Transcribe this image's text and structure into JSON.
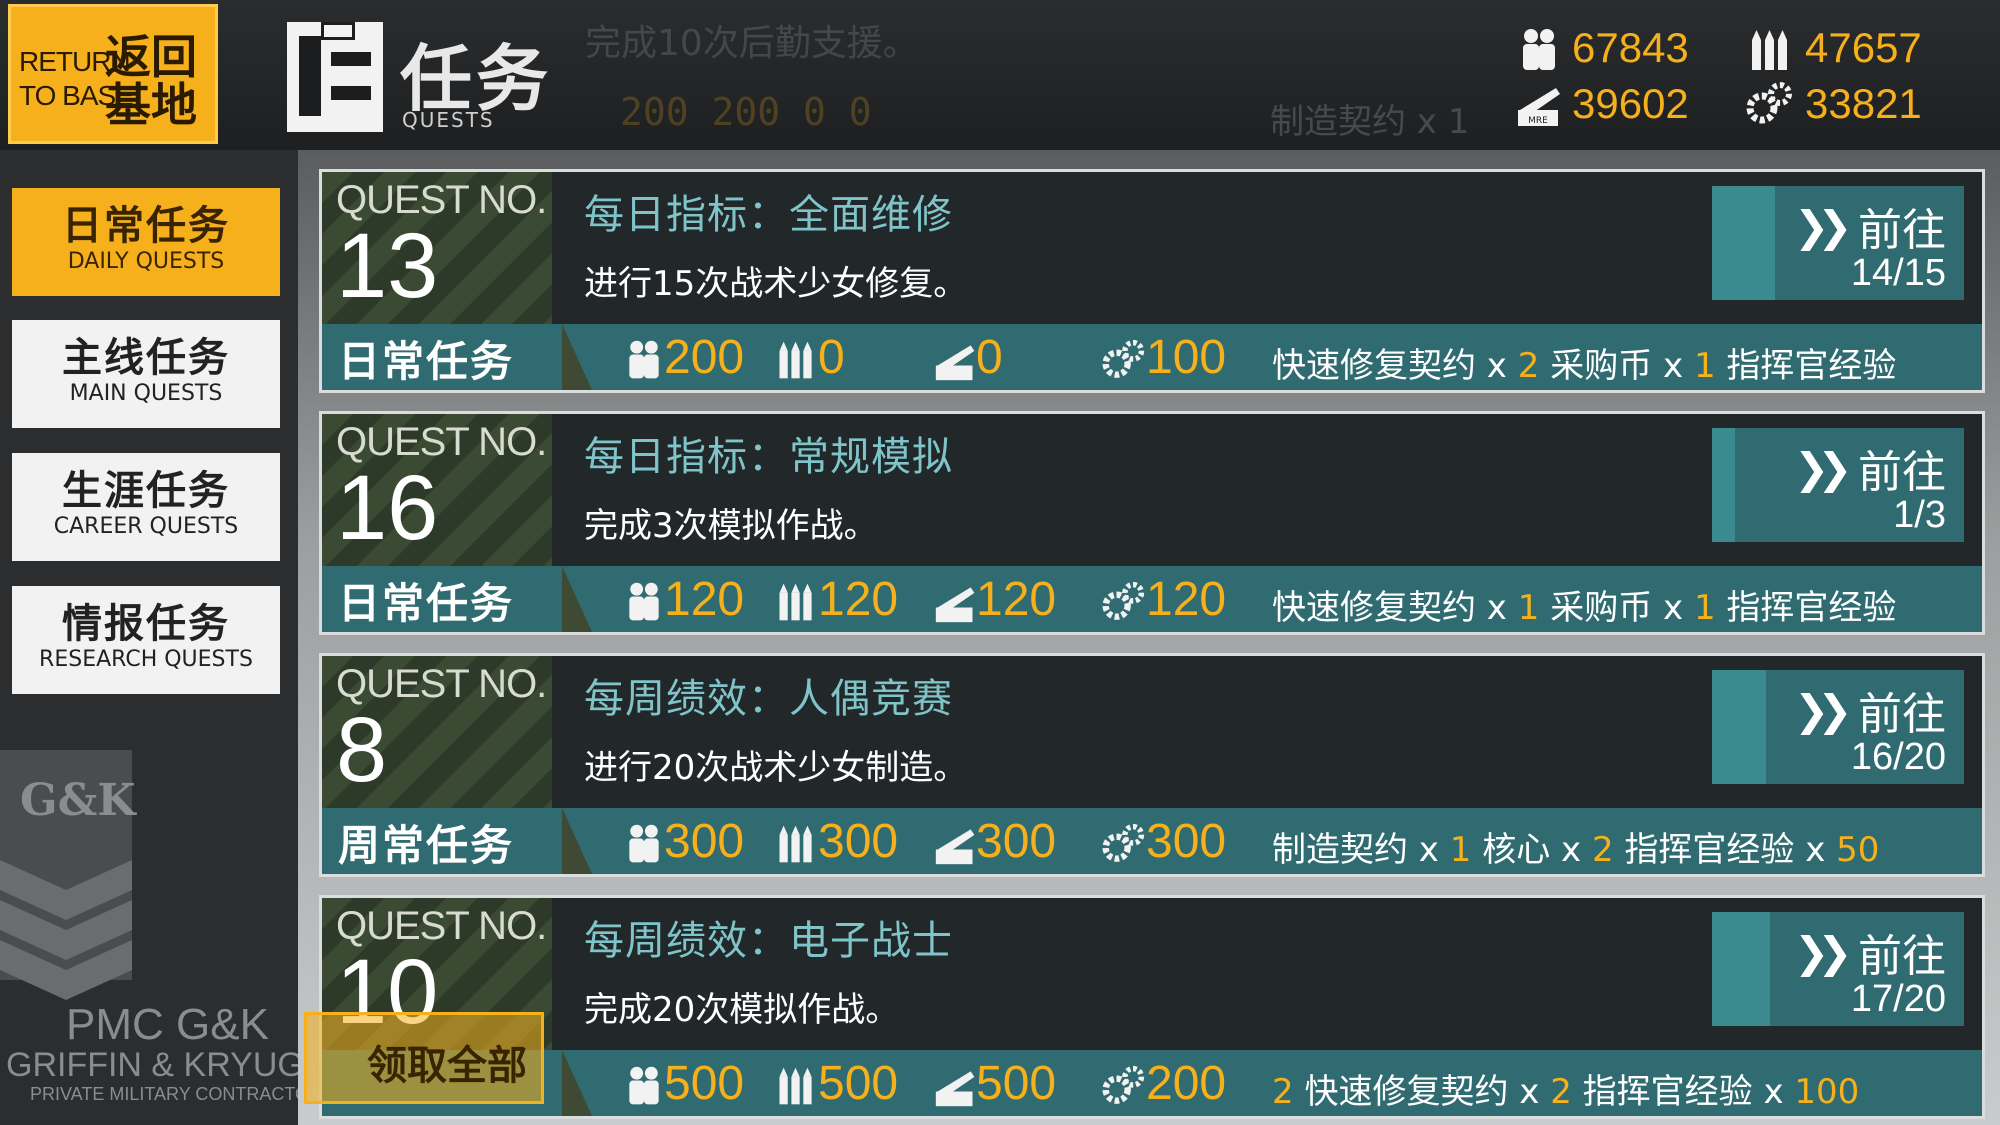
{
  "header": {
    "return_en_1": "RETURN",
    "return_en_2": "TO BASE",
    "return_cn_1": "返回",
    "return_cn_2": "基地",
    "title_cn": "任务",
    "title_en": "QUESTS",
    "ghost_desc": "完成10次后勤支援。",
    "ghost_rewards": "200 200 0 0",
    "ghost_extra": "制造契约 x 1"
  },
  "resources": {
    "manpower": "67843",
    "ammo": "47657",
    "rations": "39602",
    "parts": "33821"
  },
  "sidebar": {
    "items": [
      {
        "cn": "日常任务",
        "en": "DAILY QUESTS"
      },
      {
        "cn": "主线任务",
        "en": "MAIN QUESTS"
      },
      {
        "cn": "生涯任务",
        "en": "CAREER QUESTS"
      },
      {
        "cn": "情报任务",
        "en": "RESEARCH QUESTS"
      }
    ],
    "logo_text_1": "PMC G&K",
    "logo_text_2": "GRIFFIN & KRYUGER®",
    "logo_text_3": "PRIVATE MILITARY CONTRACTOR"
  },
  "quest_no_label": "QUEST NO.",
  "go_label": "前往",
  "claim_all": "领取全部",
  "quests": [
    {
      "no": "13",
      "title": "每日指标：全面维修",
      "desc": "进行15次战术少女修复。",
      "type": "日常任务",
      "manpower": "200",
      "ammo": "0",
      "rations": "0",
      "parts": "100",
      "extra": [
        [
          "快速修复契约 x ",
          "2"
        ],
        [
          "  采购币 x ",
          "1"
        ],
        [
          "  指挥官经验",
          ""
        ]
      ],
      "progress": "14/15",
      "progress_frac": 0.933
    },
    {
      "no": "16",
      "title": "每日指标：常规模拟",
      "desc": "完成3次模拟作战。",
      "type": "日常任务",
      "manpower": "120",
      "ammo": "120",
      "rations": "120",
      "parts": "120",
      "extra": [
        [
          "快速修复契约 x ",
          "1"
        ],
        [
          "  采购币 x ",
          "1"
        ],
        [
          "  指挥官经验",
          ""
        ]
      ],
      "progress": "1/3",
      "progress_frac": 0.333
    },
    {
      "no": "8",
      "title": "每周绩效：人偶竞赛",
      "desc": "进行20次战术少女制造。",
      "type": "周常任务",
      "manpower": "300",
      "ammo": "300",
      "rations": "300",
      "parts": "300",
      "extra": [
        [
          "制造契约 x ",
          "1"
        ],
        [
          "  核心 x ",
          "2"
        ],
        [
          "  指挥官经验 x ",
          "50"
        ]
      ],
      "progress": "16/20",
      "progress_frac": 0.8
    },
    {
      "no": "10",
      "title": "每周绩效：电子战士",
      "desc": "完成20次模拟作战。",
      "type": "",
      "manpower": "500",
      "ammo": "500",
      "rations": "500",
      "parts": "200",
      "extra": [
        [
          "",
          "2"
        ],
        [
          "  快速修复契约 x ",
          "2"
        ],
        [
          "  指挥官经验 x ",
          "100"
        ]
      ],
      "progress": "17/20",
      "progress_frac": 0.85
    }
  ],
  "colors": {
    "accent": "#f5b01c",
    "teal": "#2f6b70",
    "title_teal": "#7fc4c9"
  }
}
